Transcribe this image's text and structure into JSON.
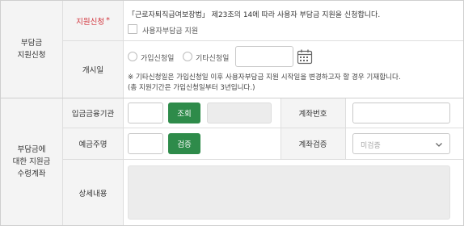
{
  "sections": {
    "burden_apply": "부담금\n지원신청",
    "account": "부담금에\n대한 지원금\n수령계좌"
  },
  "apply_row": {
    "label": "지원신청",
    "required_mark": "*",
    "statement": "「근로자퇴직급여보장법」 제23조의 14에 따라 사용자 부담금 지원을 신청합니다.",
    "checkbox_label": "사용자부담금 지원"
  },
  "start_row": {
    "label": "개시일",
    "radio_options": [
      "가입신청일",
      "기타신청일"
    ],
    "date_value": "",
    "note_1": "※ 기타신청일은 가입신청일 이후 사용자부담금 지원 시작일을 변경하고자 할 경우 기재합니다.",
    "note_2": "(총 지원기간은 가입신청일부터 3년입니다.)"
  },
  "bank_row": {
    "label": "입금금융기관",
    "code_value": "",
    "lookup_button": "조회",
    "bank_name_value": "",
    "account_label": "계좌번호",
    "account_value": ""
  },
  "holder_row": {
    "label": "예금주명",
    "holder_value": "",
    "verify_button": "검증",
    "verify_label": "계좌검증",
    "verify_status": "미검증"
  },
  "detail_row": {
    "label": "상세내용",
    "detail_value": ""
  },
  "colors": {
    "accent_green": "#2e8b4a",
    "required_red": "#d2343c",
    "label_bg": "#f4f4f4"
  },
  "icons": {
    "calendar": "calendar-icon",
    "dropdown": "chevron-down-icon"
  }
}
